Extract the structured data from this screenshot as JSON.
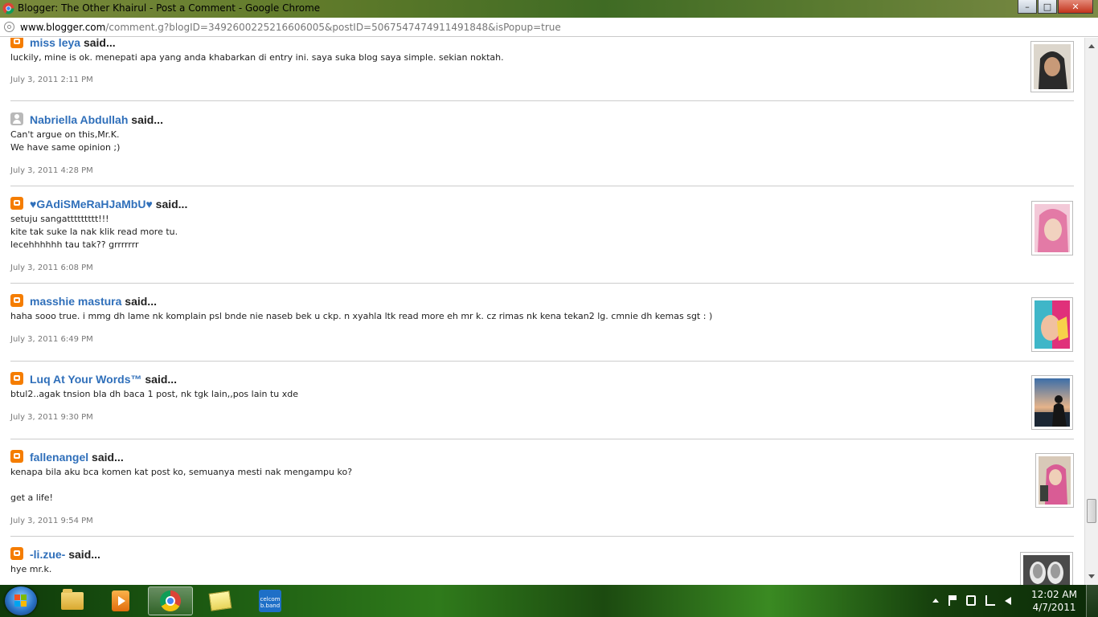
{
  "window": {
    "title": "Blogger: The Other Khairul - Post a Comment - Google Chrome",
    "minimize": "–",
    "maximize": "□",
    "close": "✕"
  },
  "address": {
    "host": "www.blogger.com",
    "path": "/comment.g?blogID=3492600225216606005&postID=5067547474911491848&isPopup=true"
  },
  "comments": [
    {
      "author": "miss leya",
      "said": "said...",
      "icon": "blogger-icon",
      "body": "luckily, mine is ok. menepati apa yang anda khabarkan di entry ini. saya suka blog saya simple. sekian noktah.",
      "time": "July 3, 2011 2:11 PM",
      "avatar_color": "#3a3a3a"
    },
    {
      "author": "Nabriella Abdullah",
      "said": "said...",
      "icon": "profile-icon",
      "body": "Can't argue on this,Mr.K.\nWe have same opinion ;)",
      "time": "July 3, 2011 4:28 PM"
    },
    {
      "author": "♥GAdiSMeRaHJaMbU♥",
      "said": "said...",
      "icon": "blogger-icon",
      "body": "setuju sangattttttttt!!!\nkite tak suke la nak klik read more tu.\nlecehhhhhh tau tak?? grrrrrrr",
      "time": "July 3, 2011 6:08 PM",
      "avatar_color": "#e89ab8"
    },
    {
      "author": "masshie mastura",
      "said": "said...",
      "icon": "blogger-icon",
      "body": "haha sooo true. i mmg dh lame nk komplain psl bnde nie naseb bek u ckp. n xyahla ltk read more eh mr k. cz rimas nk kena tekan2 lg. cmnie dh kemas sgt : )",
      "time": "July 3, 2011 6:49 PM",
      "avatar_color": "#d9307a"
    },
    {
      "author": "Luq At Your Words™",
      "said": "said...",
      "icon": "blogger-icon",
      "body": "btul2..agak tnsion bla dh baca 1 post, nk tgk lain,,pos lain tu xde",
      "time": "July 3, 2011 9:30 PM",
      "avatar_color": "#3b5878"
    },
    {
      "author": "fallenangel",
      "said": "said...",
      "icon": "blogger-icon",
      "body": "kenapa bila aku bca komen kat post ko, semuanya mesti nak mengampu ko?\n\nget a life!",
      "time": "July 3, 2011 9:54 PM",
      "avatar_color": "#c9a0b0"
    },
    {
      "author": "-li.zue-",
      "said": "said...",
      "icon": "blogger-icon",
      "body": "hye mr.k.",
      "time": "",
      "avatar_color": "#6a6a6a"
    }
  ],
  "taskbar": {
    "apps": [
      "windows-explorer",
      "windows-media-player",
      "google-chrome",
      "sticky-notes",
      "celcom-broadband"
    ],
    "celcom_label": "celcom\nb.band",
    "time": "12:02 AM",
    "date": "4/7/2011"
  }
}
